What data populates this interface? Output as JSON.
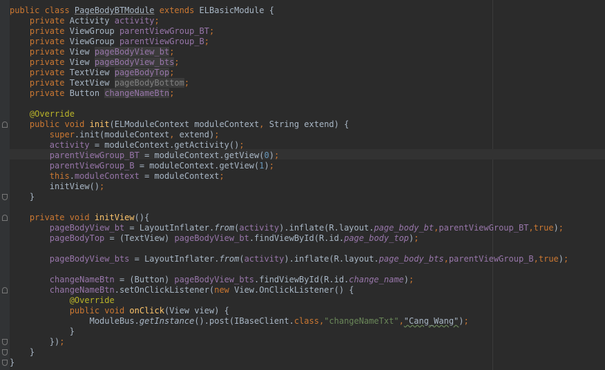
{
  "editor": {
    "colors": {
      "background": "#2b2b2b",
      "keyword": "#cc7832",
      "field": "#9876aa",
      "method": "#ffc66d",
      "number": "#6897bb",
      "string": "#6a8759",
      "annotation": "#bbb529",
      "text": "#a9b7c6"
    },
    "lines": [
      {
        "kind": "code",
        "tokens": [
          [
            "kw",
            "public class "
          ],
          [
            "ul",
            "PageBodyBTModule"
          ],
          [
            "kw",
            " extends "
          ],
          [
            "cls",
            "ELBasicModule {"
          ]
        ]
      },
      {
        "kind": "code",
        "tokens": [
          [
            "cls",
            "    "
          ],
          [
            "kw",
            "private "
          ],
          [
            "cls",
            "Activity "
          ],
          [
            "fld",
            "activity"
          ],
          [
            "kw",
            ";"
          ]
        ]
      },
      {
        "kind": "code",
        "tokens": [
          [
            "cls",
            "    "
          ],
          [
            "kw",
            "private "
          ],
          [
            "cls",
            "ViewGroup "
          ],
          [
            "fld",
            "parentViewGroup_BT"
          ],
          [
            "kw",
            ";"
          ]
        ]
      },
      {
        "kind": "code",
        "tokens": [
          [
            "cls",
            "    "
          ],
          [
            "kw",
            "private "
          ],
          [
            "cls",
            "ViewGroup "
          ],
          [
            "fld",
            "parentViewGroup_B"
          ],
          [
            "kw",
            ";"
          ]
        ]
      },
      {
        "kind": "code",
        "tokens": [
          [
            "cls",
            "    "
          ],
          [
            "kw",
            "private "
          ],
          [
            "cls",
            "View "
          ],
          [
            "unused",
            "pageBodyView_bt"
          ],
          [
            "kw",
            ";"
          ]
        ]
      },
      {
        "kind": "code",
        "tokens": [
          [
            "cls",
            "    "
          ],
          [
            "kw",
            "private "
          ],
          [
            "cls",
            "View "
          ],
          [
            "unused",
            "pageBodyView_bts"
          ],
          [
            "kw",
            ";"
          ]
        ]
      },
      {
        "kind": "code",
        "tokens": [
          [
            "cls",
            "    "
          ],
          [
            "kw",
            "private "
          ],
          [
            "cls",
            "TextView "
          ],
          [
            "unused",
            "pageBodyTop"
          ],
          [
            "kw",
            ";"
          ]
        ]
      },
      {
        "kind": "code",
        "tokens": [
          [
            "cls",
            "    "
          ],
          [
            "kw",
            "private "
          ],
          [
            "cls",
            "TextView "
          ],
          [
            "unused2",
            "pageBodyBottom"
          ],
          [
            "kw",
            ";"
          ]
        ]
      },
      {
        "kind": "code",
        "tokens": [
          [
            "cls",
            "    "
          ],
          [
            "kw",
            "private "
          ],
          [
            "cls",
            "Button "
          ],
          [
            "unused",
            "changeNameBtn"
          ],
          [
            "kw",
            ";"
          ]
        ]
      },
      {
        "kind": "blank",
        "tokens": []
      },
      {
        "kind": "code",
        "tokens": [
          [
            "cls",
            "    "
          ],
          [
            "ann",
            "@Override"
          ]
        ]
      },
      {
        "kind": "code",
        "tokens": [
          [
            "cls",
            "    "
          ],
          [
            "kw",
            "public void "
          ],
          [
            "fn",
            "init"
          ],
          [
            "cls",
            "(ELModuleContext moduleContext"
          ],
          [
            "kw",
            ", "
          ],
          [
            "cls",
            "String extend) {"
          ]
        ]
      },
      {
        "kind": "code",
        "tokens": [
          [
            "cls",
            "        "
          ],
          [
            "kw",
            "super"
          ],
          [
            "cls",
            ".init(moduleContext"
          ],
          [
            "kw",
            ", "
          ],
          [
            "cls",
            "extend)"
          ],
          [
            "kw",
            ";"
          ]
        ]
      },
      {
        "kind": "code",
        "tokens": [
          [
            "cls",
            "        "
          ],
          [
            "fld",
            "activity"
          ],
          [
            "cls",
            " = moduleContext.getActivity()"
          ],
          [
            "kw",
            ";"
          ]
        ]
      },
      {
        "kind": "code",
        "tokens": [
          [
            "cls",
            "        "
          ],
          [
            "fld",
            "parentViewGroup_BT"
          ],
          [
            "cls",
            " = moduleContext.getView("
          ],
          [
            "num",
            "0"
          ],
          [
            "cls",
            ")"
          ],
          [
            "kw",
            ";"
          ]
        ]
      },
      {
        "kind": "code",
        "tokens": [
          [
            "cls",
            "        "
          ],
          [
            "fld",
            "parentViewGroup_B"
          ],
          [
            "cls",
            " = moduleContext.getView("
          ],
          [
            "num",
            "1"
          ],
          [
            "cls",
            ")"
          ],
          [
            "kw",
            ";"
          ]
        ]
      },
      {
        "kind": "code",
        "tokens": [
          [
            "cls",
            "        "
          ],
          [
            "kw",
            "this"
          ],
          [
            "cls",
            "."
          ],
          [
            "fld",
            "moduleContext"
          ],
          [
            "cls",
            " = moduleContext"
          ],
          [
            "kw",
            ";"
          ]
        ]
      },
      {
        "kind": "code",
        "tokens": [
          [
            "cls",
            "        initView()"
          ],
          [
            "kw",
            ";"
          ]
        ]
      },
      {
        "kind": "code",
        "tokens": [
          [
            "cls",
            "    }"
          ]
        ]
      },
      {
        "kind": "blank",
        "tokens": []
      },
      {
        "kind": "code",
        "tokens": [
          [
            "cls",
            "    "
          ],
          [
            "kw",
            "private void "
          ],
          [
            "fn",
            "initView"
          ],
          [
            "cls",
            "(){"
          ]
        ]
      },
      {
        "kind": "code",
        "tokens": [
          [
            "cls",
            "        "
          ],
          [
            "fld",
            "pageBodyView_bt"
          ],
          [
            "cls",
            " = LayoutInflater."
          ],
          [
            "it",
            "from"
          ],
          [
            "cls",
            "("
          ],
          [
            "fld",
            "activity"
          ],
          [
            "cls",
            ").inflate(R.layout."
          ],
          [
            "fldit",
            "page_body_bt"
          ],
          [
            "kw",
            ","
          ],
          [
            "fld",
            "parentViewGroup_BT"
          ],
          [
            "kw",
            ","
          ],
          [
            "kw",
            "true"
          ],
          [
            "cls",
            ")"
          ],
          [
            "kw",
            ";"
          ]
        ]
      },
      {
        "kind": "code",
        "tokens": [
          [
            "cls",
            "        "
          ],
          [
            "fld",
            "pageBodyTop"
          ],
          [
            "cls",
            " = (TextView) "
          ],
          [
            "fld",
            "pageBodyView_bt"
          ],
          [
            "cls",
            ".findViewById(R.id."
          ],
          [
            "fldit",
            "page_body_top"
          ],
          [
            "cls",
            ")"
          ],
          [
            "kw",
            ";"
          ]
        ]
      },
      {
        "kind": "blank",
        "tokens": []
      },
      {
        "kind": "code",
        "tokens": [
          [
            "cls",
            "        "
          ],
          [
            "fld",
            "pageBodyView_bts"
          ],
          [
            "cls",
            " = LayoutInflater."
          ],
          [
            "it",
            "from"
          ],
          [
            "cls",
            "("
          ],
          [
            "fld",
            "activity"
          ],
          [
            "cls",
            ").inflate(R.layout."
          ],
          [
            "fldit",
            "page_body_bts"
          ],
          [
            "kw",
            ","
          ],
          [
            "fld",
            "parentViewGroup_B"
          ],
          [
            "kw",
            ","
          ],
          [
            "kw",
            "true"
          ],
          [
            "cls",
            ")"
          ],
          [
            "kw",
            ";"
          ]
        ]
      },
      {
        "kind": "blank",
        "tokens": []
      },
      {
        "kind": "code",
        "tokens": [
          [
            "cls",
            "        "
          ],
          [
            "fld",
            "changeNameBtn"
          ],
          [
            "cls",
            " = (Button) "
          ],
          [
            "fld",
            "pageBodyView_bts"
          ],
          [
            "cls",
            ".findViewById(R.id."
          ],
          [
            "fldit",
            "change_name"
          ],
          [
            "cls",
            ")"
          ],
          [
            "kw",
            ";"
          ]
        ]
      },
      {
        "kind": "code",
        "tokens": [
          [
            "cls",
            "        "
          ],
          [
            "fld",
            "changeNameBtn"
          ],
          [
            "cls",
            ".setOnClickListener("
          ],
          [
            "kw",
            "new "
          ],
          [
            "cls",
            "View.OnClickListener() {"
          ]
        ]
      },
      {
        "kind": "code",
        "tokens": [
          [
            "cls",
            "            "
          ],
          [
            "ann",
            "@Override"
          ]
        ]
      },
      {
        "kind": "code",
        "tokens": [
          [
            "cls",
            "            "
          ],
          [
            "kw",
            "public void "
          ],
          [
            "fn",
            "onClick"
          ],
          [
            "cls",
            "(View view) {"
          ]
        ]
      },
      {
        "kind": "code",
        "tokens": [
          [
            "cls",
            "                ModuleBus."
          ],
          [
            "it",
            "getInstance"
          ],
          [
            "cls",
            "().post(IBaseClient."
          ],
          [
            "kw",
            "class"
          ],
          [
            "kw",
            ","
          ],
          [
            "str",
            "\"changeNameTxt\""
          ],
          [
            "kw",
            ","
          ],
          [
            "wavy",
            "\"Cang_Wang\""
          ],
          [
            "cls",
            ")"
          ],
          [
            "kw",
            ";"
          ]
        ]
      },
      {
        "kind": "code",
        "tokens": [
          [
            "cls",
            "            }"
          ]
        ]
      },
      {
        "kind": "code",
        "tokens": [
          [
            "cls",
            "        })"
          ],
          [
            "kw",
            ";"
          ]
        ]
      },
      {
        "kind": "code",
        "tokens": [
          [
            "cls",
            "    }"
          ]
        ]
      },
      {
        "kind": "code",
        "tokens": [
          [
            "cls",
            "}"
          ]
        ]
      }
    ]
  }
}
